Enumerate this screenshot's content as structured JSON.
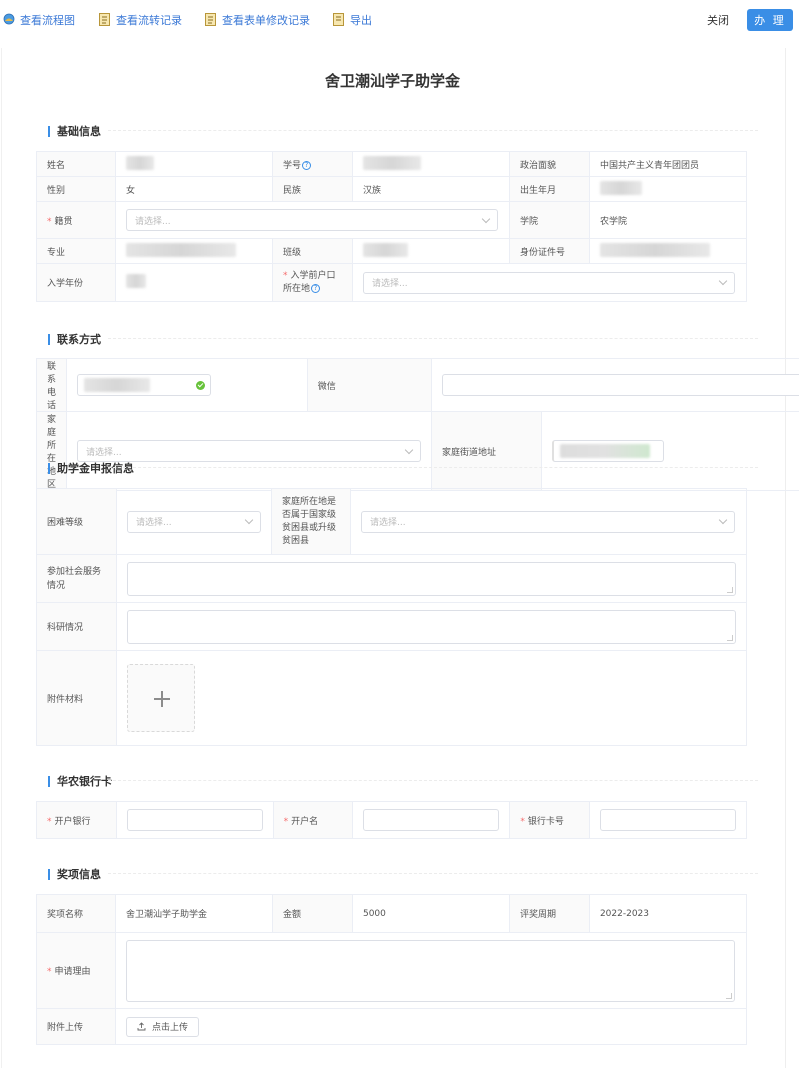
{
  "toolbar": {
    "view_flowchart": "查看流程图",
    "view_transfer_records": "查看流转记录",
    "view_form_edit_records": "查看表单修改记录",
    "export": "导出",
    "close": "关闭",
    "handle": "办 理"
  },
  "form": {
    "title": "舍卫潮汕学子助学金"
  },
  "basic": {
    "section_title": "基础信息",
    "name_label": "姓名",
    "student_id_label": "学号",
    "political_label": "政治面貌",
    "political_value": "中国共产主义青年团团员",
    "gender_label": "性别",
    "gender_value": "女",
    "ethnicity_label": "民族",
    "ethnicity_value": "汉族",
    "birth_label": "出生年月",
    "native_label": "籍贯",
    "native_placeholder": "请选择...",
    "college_label": "学院",
    "college_value": "农学院",
    "major_label": "专业",
    "class_label": "班级",
    "id_label": "身份证件号",
    "enroll_label": "入学年份",
    "hukou_label_1": "入学前户口",
    "hukou_label_2": "所在地",
    "hukou_placeholder": "请选择..."
  },
  "contact": {
    "section_title": "联系方式",
    "phone_label": "联系电话",
    "wechat_label": "微信",
    "region_label": "家庭所在地区",
    "region_placeholder": "请选择...",
    "street_label": "家庭街道地址"
  },
  "apply": {
    "section_title": "助学金申报信息",
    "difficulty_label": "困难等级",
    "difficulty_placeholder": "请选择...",
    "poor_county_label_1": "家庭所在地是",
    "poor_county_label_2": "否属于国家级",
    "poor_county_label_3": "贫困县或升级",
    "poor_county_label_4": "贫困县",
    "poor_county_placeholder": "请选择...",
    "social_label_1": "参加社会服务",
    "social_label_2": "情况",
    "research_label": "科研情况",
    "attachment_label": "附件材料"
  },
  "bank": {
    "section_title": "华农银行卡",
    "bank_label": "开户银行",
    "holder_label": "开户名",
    "card_label": "银行卡号"
  },
  "award": {
    "section_title": "奖项信息",
    "award_name_label": "奖项名称",
    "award_name_value": "舍卫潮汕学子助学金",
    "amount_label": "金额",
    "amount_value": "5000",
    "period_label": "评奖周期",
    "period_value": "2022-2023",
    "reason_label": "申请理由",
    "upload_label": "附件上传",
    "upload_button": "点击上传"
  },
  "icons": [
    "flowchart-icon",
    "document-icon",
    "export-icon",
    "question-icon",
    "check-circle-icon",
    "plus-icon",
    "upload-icon",
    "chevron-down-icon"
  ],
  "colors": {
    "accent": "#3a8ee6",
    "link": "#3a78d6",
    "required": "#f56c6c",
    "success": "#67c23a"
  }
}
